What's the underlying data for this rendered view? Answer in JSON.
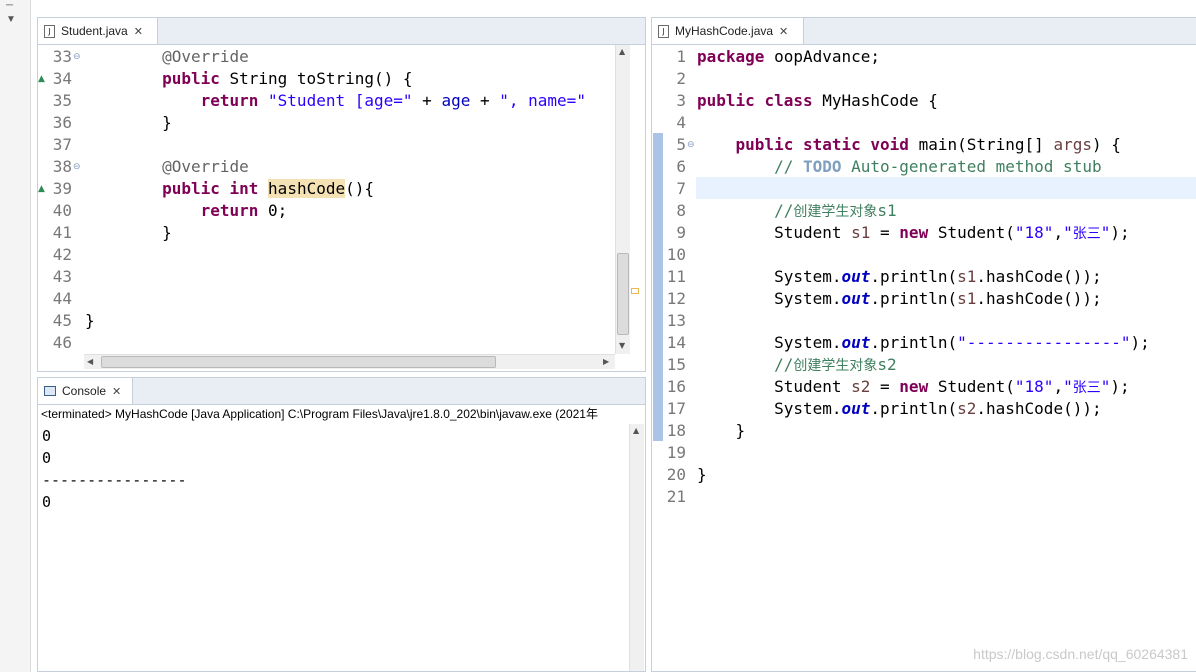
{
  "student_editor": {
    "tab_label": "Student.java",
    "lines": [
      {
        "n": "33",
        "html": "        <span class=\"ann\">@Override</span>"
      },
      {
        "n": "34",
        "html": "        <span class=\"kw\">public</span> String toString() {"
      },
      {
        "n": "35",
        "html": "            <span class=\"kw\">return</span> <span class=\"str\">\"Student [age=\"</span> + <span style=\"color:#0000c0\">age</span> + <span class=\"str\">\", name=\"</span>"
      },
      {
        "n": "36",
        "html": "        }"
      },
      {
        "n": "37",
        "html": ""
      },
      {
        "n": "38",
        "html": "        <span class=\"ann\">@Override</span>"
      },
      {
        "n": "39",
        "html": "        <span class=\"kw\">public</span> <span class=\"kw\">int</span> <span class=\"hl\">hashCode</span>(){"
      },
      {
        "n": "40",
        "html": "            <span class=\"kw\">return</span> 0;"
      },
      {
        "n": "41",
        "html": "        }"
      },
      {
        "n": "42",
        "html": ""
      },
      {
        "n": "43",
        "html": ""
      },
      {
        "n": "44",
        "html": ""
      },
      {
        "n": "45",
        "html": "}"
      },
      {
        "n": "46",
        "html": ""
      }
    ]
  },
  "console": {
    "tab_label": "Console",
    "status": "<terminated> MyHashCode [Java Application] C:\\Program Files\\Java\\jre1.8.0_202\\bin\\javaw.exe (2021年",
    "output": [
      "0",
      "0",
      "----------------",
      "0"
    ]
  },
  "main_editor": {
    "tab_label": "MyHashCode.java",
    "lines": [
      {
        "n": "1",
        "html": "<span class=\"kw\">package</span> oopAdvance;"
      },
      {
        "n": "2",
        "html": ""
      },
      {
        "n": "3",
        "html": "<span class=\"kw\">public</span> <span class=\"kw\">class</span> MyHashCode {"
      },
      {
        "n": "4",
        "html": ""
      },
      {
        "n": "5",
        "html": "    <span class=\"kw\">public</span> <span class=\"kw\">static</span> <span class=\"kw\">void</span> main(String[] <span class=\"var\">args</span>) {"
      },
      {
        "n": "6",
        "html": "        <span class=\"cmt\">// </span><span class=\"todo\">TODO</span><span class=\"cmt\"> Auto-generated method stub</span>"
      },
      {
        "n": "7",
        "html": ""
      },
      {
        "n": "8",
        "html": "        <span class=\"cmt\">//<span class=\"cjk\">创建学生对象</span>s1</span>"
      },
      {
        "n": "9",
        "html": "        Student <span class=\"var\">s1</span> = <span class=\"kw\">new</span> Student(<span class=\"str\">\"18\"</span>,<span class=\"str\">\"<span class=\"cjk\">张三</span>\"</span>);"
      },
      {
        "n": "10",
        "html": ""
      },
      {
        "n": "11",
        "html": "        System.<span class=\"fld\">out</span>.println(<span class=\"var\">s1</span>.hashCode());"
      },
      {
        "n": "12",
        "html": "        System.<span class=\"fld\">out</span>.println(<span class=\"var\">s1</span>.hashCode());"
      },
      {
        "n": "13",
        "html": ""
      },
      {
        "n": "14",
        "html": "        System.<span class=\"fld\">out</span>.println(<span class=\"str\">\"----------------\"</span>);"
      },
      {
        "n": "15",
        "html": "        <span class=\"cmt\">//<span class=\"cjk\">创建学生对象</span>s2</span>"
      },
      {
        "n": "16",
        "html": "        Student <span class=\"var\">s2</span> = <span class=\"kw\">new</span> Student(<span class=\"str\">\"18\"</span>,<span class=\"str\">\"<span class=\"cjk\">张三</span>\"</span>);"
      },
      {
        "n": "17",
        "html": "        System.<span class=\"fld\">out</span>.println(<span class=\"var\">s2</span>.hashCode());"
      },
      {
        "n": "18",
        "html": "    }"
      },
      {
        "n": "19",
        "html": ""
      },
      {
        "n": "20",
        "html": "}"
      },
      {
        "n": "21",
        "html": ""
      }
    ]
  },
  "watermark": "https://blog.csdn.net/qq_60264381"
}
